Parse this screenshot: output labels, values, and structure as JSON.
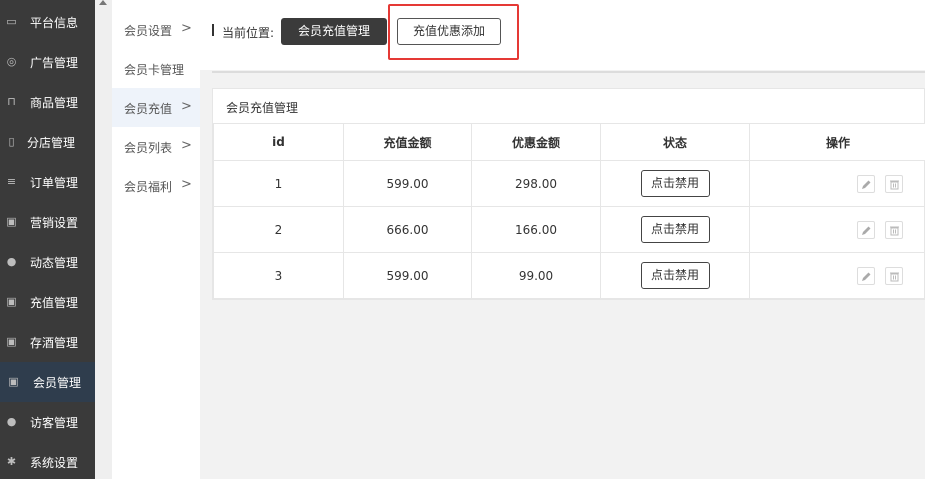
{
  "sidebar": {
    "items": [
      {
        "label": "平台信息",
        "icon": "monitor-icon"
      },
      {
        "label": "广告管理",
        "icon": "support-icon"
      },
      {
        "label": "商品管理",
        "icon": "cart-icon"
      },
      {
        "label": "分店管理",
        "icon": "building-icon"
      },
      {
        "label": "订单管理",
        "icon": "list-icon"
      },
      {
        "label": "营销设置",
        "icon": "gift-icon"
      },
      {
        "label": "动态管理",
        "icon": "user-icon"
      },
      {
        "label": "充值管理",
        "icon": "gift-icon"
      },
      {
        "label": "存酒管理",
        "icon": "gift-icon"
      },
      {
        "label": "会员管理",
        "icon": "gift-icon",
        "active": true
      },
      {
        "label": "访客管理",
        "icon": "user-icon"
      },
      {
        "label": "系统设置",
        "icon": "gear-icon"
      }
    ]
  },
  "submenu": {
    "items": [
      {
        "label": "会员设置",
        "chevron": ">"
      },
      {
        "label": "会员卡管理",
        "chevron": ""
      },
      {
        "label": "会员充值",
        "chevron": ">",
        "active": true
      },
      {
        "label": "会员列表",
        "chevron": ">"
      },
      {
        "label": "会员福利",
        "chevron": ">"
      }
    ]
  },
  "topbar": {
    "location_label": "当前位置:",
    "current_button": "会员充值管理",
    "add_button": "充值优惠添加"
  },
  "panel": {
    "title": "会员充值管理",
    "columns": [
      "id",
      "充值金额",
      "优惠金额",
      "状态",
      "操作"
    ],
    "rows": [
      {
        "id": "1",
        "amount": "599.00",
        "discount": "298.00",
        "status": "点击禁用"
      },
      {
        "id": "2",
        "amount": "666.00",
        "discount": "166.00",
        "status": "点击禁用"
      },
      {
        "id": "3",
        "amount": "599.00",
        "discount": "99.00",
        "status": "点击禁用"
      }
    ]
  },
  "colors": {
    "sidebar_bg": "#3a3a3a",
    "sidebar_active": "#2f3d4d",
    "highlight": "#e53935",
    "dark_button": "#3b3b3b"
  }
}
